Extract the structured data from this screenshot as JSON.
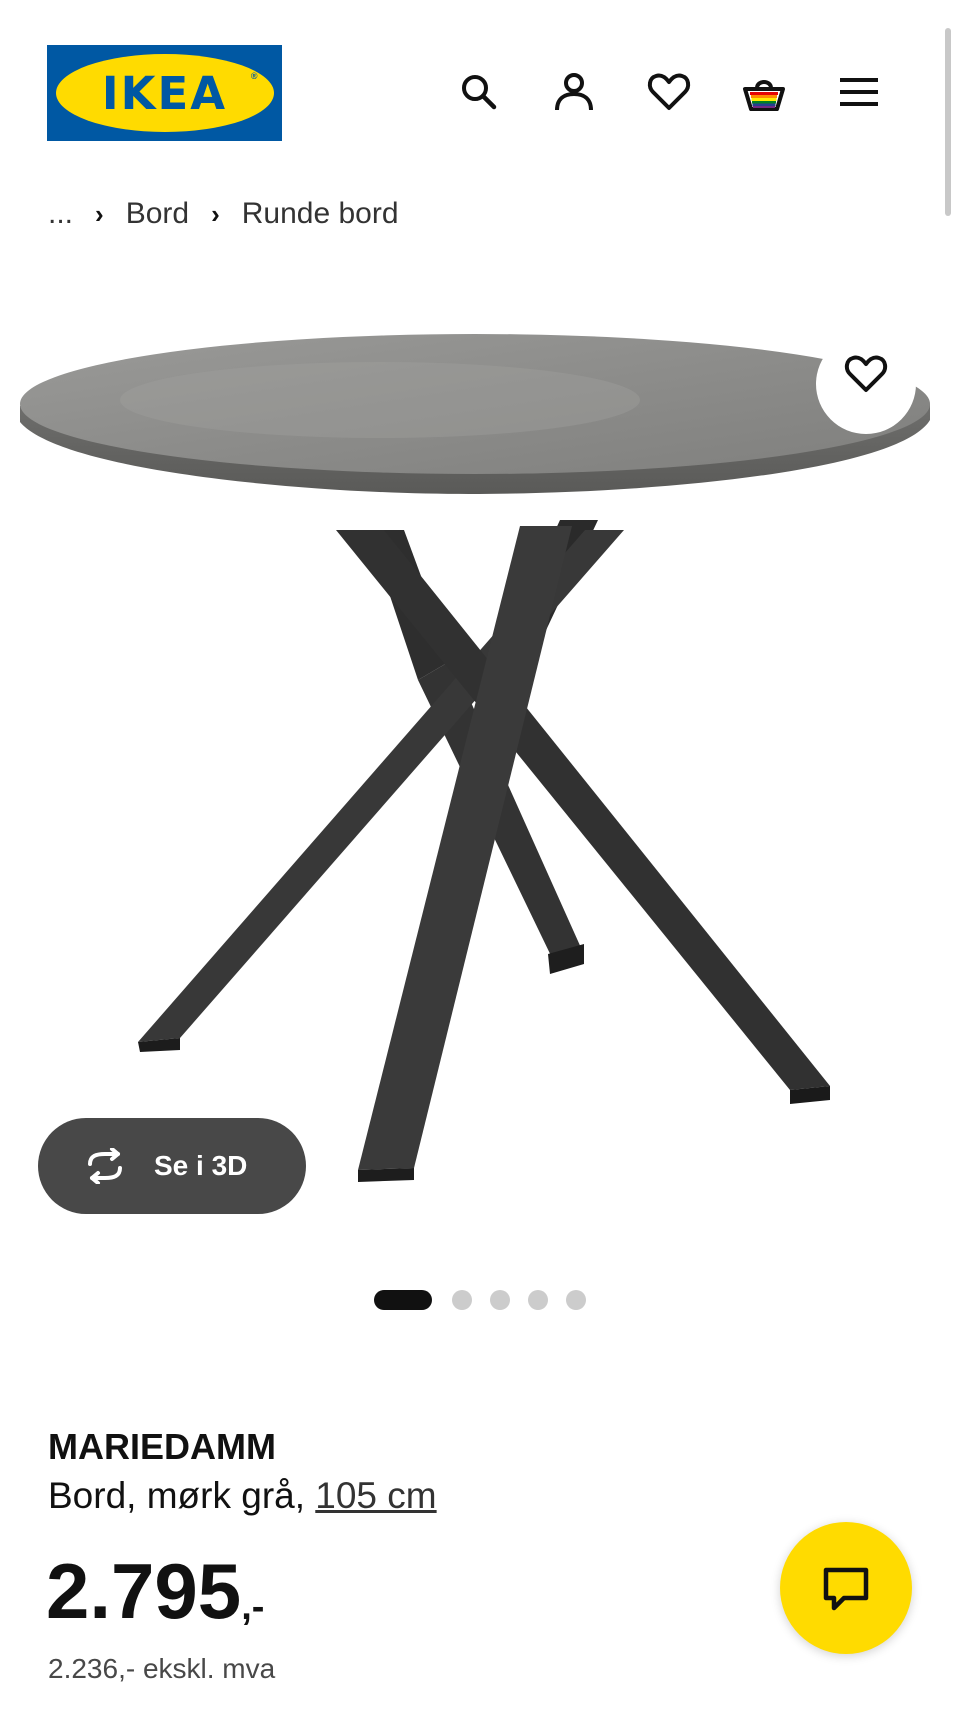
{
  "header": {
    "logo_text": "IKEA",
    "logo_reg": "®",
    "icons": [
      "search-icon",
      "account-icon",
      "heart-icon",
      "basket-icon",
      "menu-icon"
    ]
  },
  "breadcrumb": {
    "ellipsis": "...",
    "items": [
      "Bord",
      "Runde bord"
    ]
  },
  "gallery": {
    "view_3d_label": "Se i 3D",
    "slide_count": 5,
    "active_slide": 1
  },
  "product": {
    "name": "MARIEDAMM",
    "description": "Bord, mørk grå, ",
    "size": "105 cm",
    "price_main": "2.795",
    "price_suffix": ",-",
    "price_ex_vat": "2.236,- ekskl. mva"
  },
  "colors": {
    "brand_blue": "#0058a3",
    "brand_yellow": "#ffdb00",
    "pill_grey": "#484848"
  }
}
